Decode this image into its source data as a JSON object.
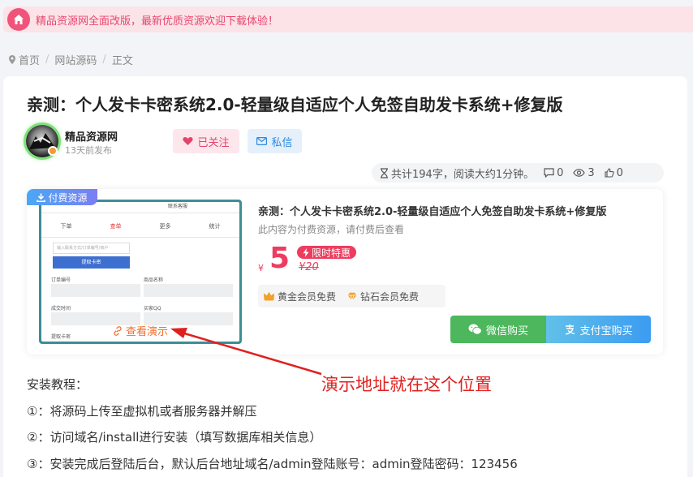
{
  "notice": {
    "text": "精品资源网全面改版，最新优质资源欢迎下载体验！",
    "icon": "home-icon"
  },
  "breadcrumb": {
    "items": [
      "首页",
      "网站源码",
      "正文"
    ]
  },
  "article": {
    "title": "亲测：个人发卡卡密系统2.0-轻量级自适应个人免签自助发卡系统+修复版",
    "author": "精品资源网",
    "posted": "13天前发布",
    "follow_label": "已关注",
    "message_label": "私信",
    "meta": {
      "word_info": "共计194字，阅读大约1分钟。",
      "comments": "0",
      "views": "3",
      "likes": "0"
    }
  },
  "pay": {
    "tag": "付费资源",
    "title": "亲测：个人发卡卡密系统2.0-轻量级自适应个人免签自助发卡系统+修复版",
    "desc": "此内容为付费资源，请付费后查看",
    "currency": "¥",
    "price": "5",
    "promo": "限时特惠",
    "original_price": "¥20",
    "perks": [
      "黄金会员免费",
      "钻石会员免费"
    ],
    "wechat_label": "微信购买",
    "alipay_label": "支付宝购买",
    "demo_label": "查看演示",
    "thumb": {
      "nav": [
        "下单",
        "查单",
        "更多",
        "统计"
      ],
      "input_placeholder": "输入联系方式/订单编号/商户",
      "query_button": "提取卡密",
      "labels": [
        "订单编号",
        "商品名称",
        "成交时间",
        "买家QQ",
        "提取卡密"
      ],
      "top_text": "联系客服"
    }
  },
  "annotation": "演示地址就在这个位置",
  "install": {
    "heading": "安装教程：",
    "steps": [
      "①：将源码上传至虚拟机或者服务器并解压",
      "②：访问域名/install进行安装（填写数据库相关信息）",
      "③：安装完成后登陆后台，默认后台地址域名/admin登陆账号：admin登陆密码：123456"
    ]
  },
  "colors": {
    "accent_pink": "#ee3c5e",
    "wechat_green": "#4cb75c",
    "alipay_blue": "#3b9cf2",
    "annotation_red": "#e0201f"
  }
}
